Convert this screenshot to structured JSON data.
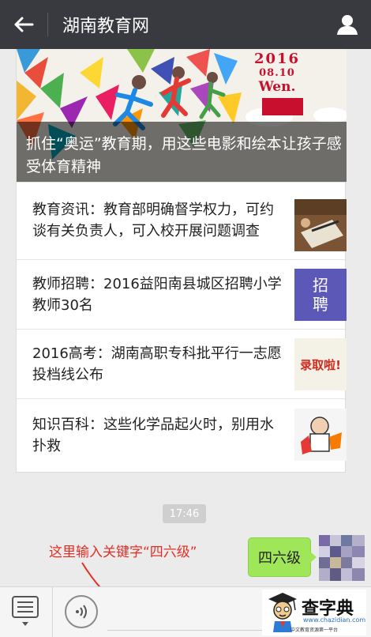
{
  "header": {
    "title": "湖南教育网",
    "back_icon": "arrow-left-icon",
    "profile_icon": "person-icon"
  },
  "feature": {
    "banner_year": "2016",
    "banner_date": "08.10",
    "banner_weekday": "Wen.",
    "title": "抓住“奥运”教育期，用这些电影和绘本让孩子感受体育精神"
  },
  "articles": [
    {
      "title": "教育资讯：教育部明确督学权力，可约谈有关负责人，可入校开展问题调查"
    },
    {
      "title": "教师招聘：2016益阳南县城区招聘小学教师30名",
      "thumb_text": "招聘"
    },
    {
      "title": "2016高考：湖南高职专科批平行一志愿投档线公布",
      "thumb_text": "录取啦!"
    },
    {
      "title": "知识百科：这些化学品起火时，别用水扑救"
    }
  ],
  "chat": {
    "timestamp": "17:46",
    "hint": "这里输入关键字“四六级”",
    "message": "四六级"
  },
  "watermark": {
    "name": "查字典",
    "url": "www.chazidian.com",
    "sub": "中文教育资源第一平台"
  },
  "colors": {
    "header_bg": "#393a3f",
    "bubble": "#9fe658",
    "hint": "#e03024"
  }
}
